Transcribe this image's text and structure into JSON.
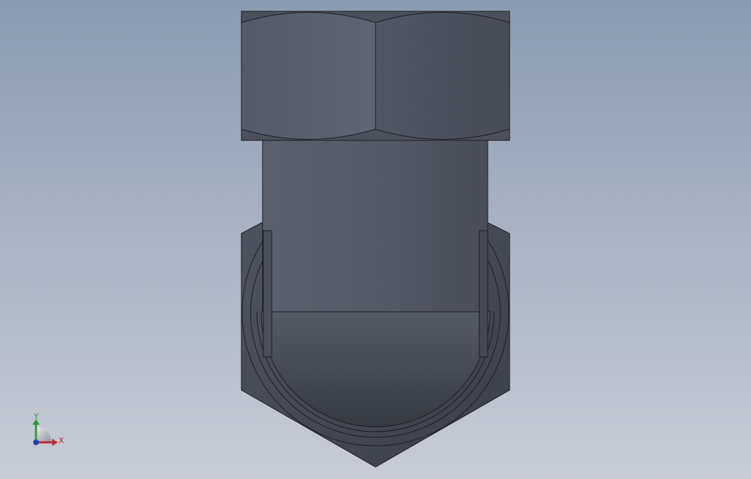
{
  "viewport": {
    "background_top": "#8b9bb0",
    "background_bottom": "#c8ccd6"
  },
  "model": {
    "part": "hex-nut-elbow-fitting",
    "view": "front",
    "shade_light": "#5c6270",
    "shade_dark": "#3a3e47",
    "edge_color": "#1b1d22"
  },
  "triad": {
    "x_label": "X",
    "y_label": "Y",
    "x_color": "#c0282c",
    "y_color": "#2c9c3a",
    "z_color": "#1f3fb0"
  }
}
